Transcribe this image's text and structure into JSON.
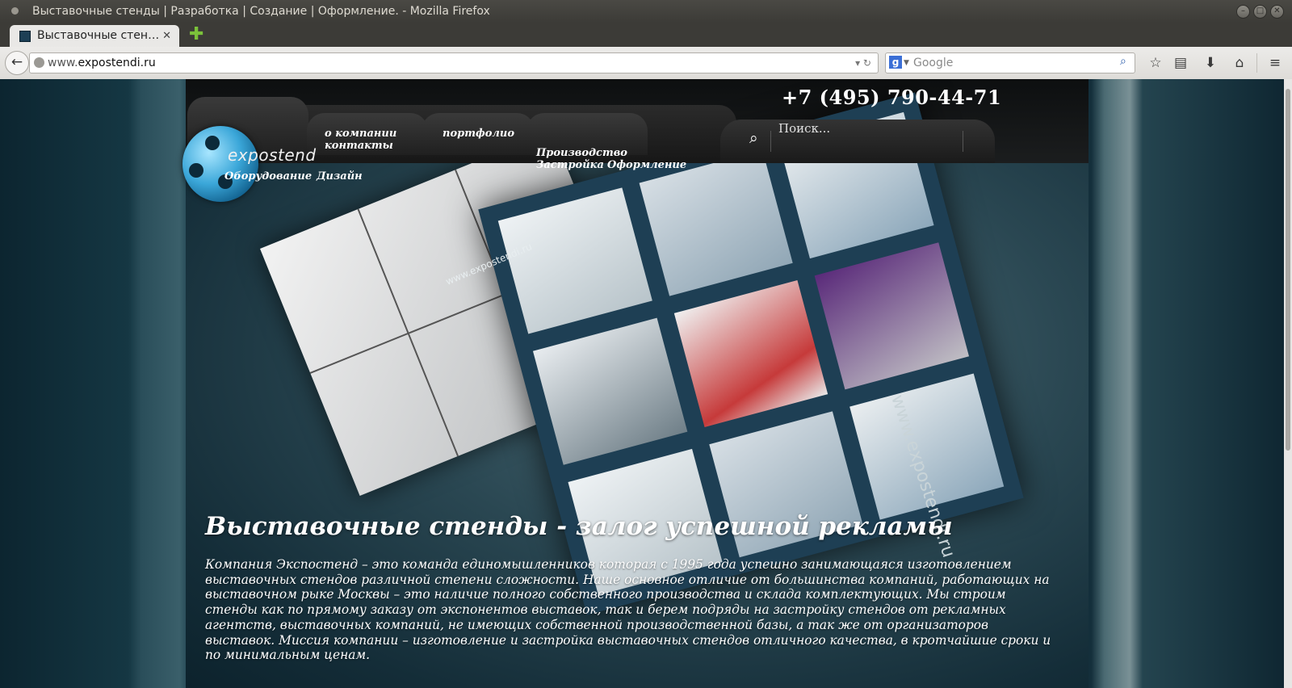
{
  "window": {
    "title": "Выставочные стенды | Разработка | Создание | Оформление. - Mozilla Firefox",
    "controls": [
      "–",
      "□",
      "✕"
    ]
  },
  "tab": {
    "label": "Выставочные стен…",
    "close": "✕",
    "new_tab": "✚"
  },
  "navbar": {
    "back": "←",
    "url_prefix": "www.",
    "url_domain": "expostendi.ru",
    "url_controls": "▾ ↻",
    "search_engine": "g",
    "search_dropdown": "▼",
    "search_placeholder": "Google",
    "search_icon": "⌕",
    "icons": {
      "bookmark": "☆",
      "reader": "▤",
      "download": "⬇",
      "home": "⌂",
      "menu": "≡"
    }
  },
  "site": {
    "phone": "+7 (495) 790-44-71",
    "search_placeholder": "Поиск...",
    "search_icon": "⌕",
    "logo_text": "expostend",
    "menu": {
      "about": "о компании",
      "contacts": "контакты",
      "portfolio": "портфолио",
      "production": "Производство",
      "construction": "Застройка",
      "decoration": "Оформление",
      "equipment": "Оборудование",
      "design": "Дизайн"
    },
    "watermark": "www.expostendi.ru",
    "heading": "Выставочные стенды - залог успешной рекламы",
    "body": "Компания Экспостенд – это команда единомышленников которая с 1995 года успешно занимающаяся изготовлением выставочных стендов различной степени сложности. Наше основное отличие от большинства компаний, работающих на выставочном рыке Москвы – это наличие полного собственного производства и склада комплектующих. Мы строим стенды как по прямому заказу от экспонентов выставок, так и берем подряды на застройку стендов от рекламных агентств, выставочных компаний, не имеющих собственной производственной базы, а так же от организаторов выставок. Миссия компании – изготовление и застройка выставочных стендов отличного качества, в кротчайшие сроки и по минимальным ценам."
  }
}
